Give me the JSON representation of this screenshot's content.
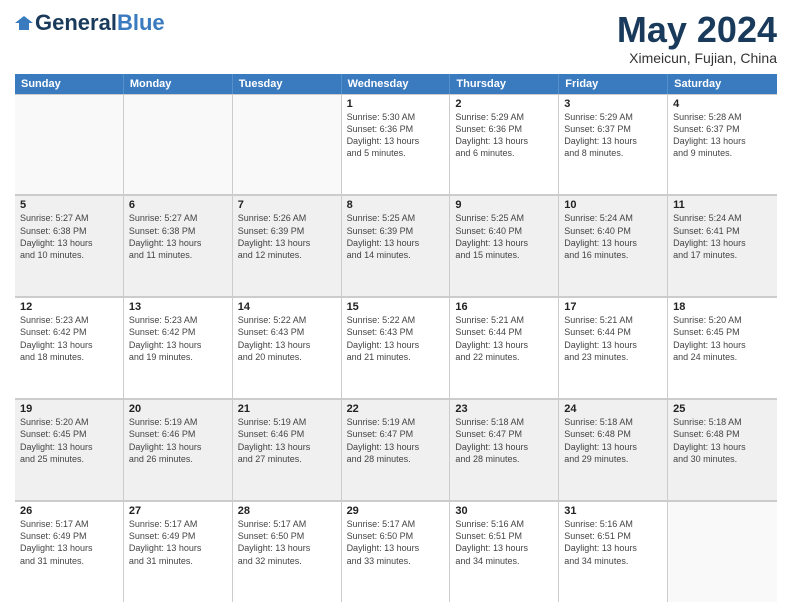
{
  "header": {
    "logo_general": "General",
    "logo_blue": "Blue",
    "month": "May 2024",
    "location": "Ximeicun, Fujian, China"
  },
  "days_of_week": [
    "Sunday",
    "Monday",
    "Tuesday",
    "Wednesday",
    "Thursday",
    "Friday",
    "Saturday"
  ],
  "rows": [
    [
      {
        "day": "",
        "info": "",
        "empty": true
      },
      {
        "day": "",
        "info": "",
        "empty": true
      },
      {
        "day": "",
        "info": "",
        "empty": true
      },
      {
        "day": "1",
        "info": "Sunrise: 5:30 AM\nSunset: 6:36 PM\nDaylight: 13 hours\nand 5 minutes."
      },
      {
        "day": "2",
        "info": "Sunrise: 5:29 AM\nSunset: 6:36 PM\nDaylight: 13 hours\nand 6 minutes."
      },
      {
        "day": "3",
        "info": "Sunrise: 5:29 AM\nSunset: 6:37 PM\nDaylight: 13 hours\nand 8 minutes."
      },
      {
        "day": "4",
        "info": "Sunrise: 5:28 AM\nSunset: 6:37 PM\nDaylight: 13 hours\nand 9 minutes."
      }
    ],
    [
      {
        "day": "5",
        "info": "Sunrise: 5:27 AM\nSunset: 6:38 PM\nDaylight: 13 hours\nand 10 minutes."
      },
      {
        "day": "6",
        "info": "Sunrise: 5:27 AM\nSunset: 6:38 PM\nDaylight: 13 hours\nand 11 minutes."
      },
      {
        "day": "7",
        "info": "Sunrise: 5:26 AM\nSunset: 6:39 PM\nDaylight: 13 hours\nand 12 minutes."
      },
      {
        "day": "8",
        "info": "Sunrise: 5:25 AM\nSunset: 6:39 PM\nDaylight: 13 hours\nand 14 minutes."
      },
      {
        "day": "9",
        "info": "Sunrise: 5:25 AM\nSunset: 6:40 PM\nDaylight: 13 hours\nand 15 minutes."
      },
      {
        "day": "10",
        "info": "Sunrise: 5:24 AM\nSunset: 6:40 PM\nDaylight: 13 hours\nand 16 minutes."
      },
      {
        "day": "11",
        "info": "Sunrise: 5:24 AM\nSunset: 6:41 PM\nDaylight: 13 hours\nand 17 minutes."
      }
    ],
    [
      {
        "day": "12",
        "info": "Sunrise: 5:23 AM\nSunset: 6:42 PM\nDaylight: 13 hours\nand 18 minutes."
      },
      {
        "day": "13",
        "info": "Sunrise: 5:23 AM\nSunset: 6:42 PM\nDaylight: 13 hours\nand 19 minutes."
      },
      {
        "day": "14",
        "info": "Sunrise: 5:22 AM\nSunset: 6:43 PM\nDaylight: 13 hours\nand 20 minutes."
      },
      {
        "day": "15",
        "info": "Sunrise: 5:22 AM\nSunset: 6:43 PM\nDaylight: 13 hours\nand 21 minutes."
      },
      {
        "day": "16",
        "info": "Sunrise: 5:21 AM\nSunset: 6:44 PM\nDaylight: 13 hours\nand 22 minutes."
      },
      {
        "day": "17",
        "info": "Sunrise: 5:21 AM\nSunset: 6:44 PM\nDaylight: 13 hours\nand 23 minutes."
      },
      {
        "day": "18",
        "info": "Sunrise: 5:20 AM\nSunset: 6:45 PM\nDaylight: 13 hours\nand 24 minutes."
      }
    ],
    [
      {
        "day": "19",
        "info": "Sunrise: 5:20 AM\nSunset: 6:45 PM\nDaylight: 13 hours\nand 25 minutes."
      },
      {
        "day": "20",
        "info": "Sunrise: 5:19 AM\nSunset: 6:46 PM\nDaylight: 13 hours\nand 26 minutes."
      },
      {
        "day": "21",
        "info": "Sunrise: 5:19 AM\nSunset: 6:46 PM\nDaylight: 13 hours\nand 27 minutes."
      },
      {
        "day": "22",
        "info": "Sunrise: 5:19 AM\nSunset: 6:47 PM\nDaylight: 13 hours\nand 28 minutes."
      },
      {
        "day": "23",
        "info": "Sunrise: 5:18 AM\nSunset: 6:47 PM\nDaylight: 13 hours\nand 28 minutes."
      },
      {
        "day": "24",
        "info": "Sunrise: 5:18 AM\nSunset: 6:48 PM\nDaylight: 13 hours\nand 29 minutes."
      },
      {
        "day": "25",
        "info": "Sunrise: 5:18 AM\nSunset: 6:48 PM\nDaylight: 13 hours\nand 30 minutes."
      }
    ],
    [
      {
        "day": "26",
        "info": "Sunrise: 5:17 AM\nSunset: 6:49 PM\nDaylight: 13 hours\nand 31 minutes."
      },
      {
        "day": "27",
        "info": "Sunrise: 5:17 AM\nSunset: 6:49 PM\nDaylight: 13 hours\nand 31 minutes."
      },
      {
        "day": "28",
        "info": "Sunrise: 5:17 AM\nSunset: 6:50 PM\nDaylight: 13 hours\nand 32 minutes."
      },
      {
        "day": "29",
        "info": "Sunrise: 5:17 AM\nSunset: 6:50 PM\nDaylight: 13 hours\nand 33 minutes."
      },
      {
        "day": "30",
        "info": "Sunrise: 5:16 AM\nSunset: 6:51 PM\nDaylight: 13 hours\nand 34 minutes."
      },
      {
        "day": "31",
        "info": "Sunrise: 5:16 AM\nSunset: 6:51 PM\nDaylight: 13 hours\nand 34 minutes."
      },
      {
        "day": "",
        "info": "",
        "empty": true
      }
    ]
  ]
}
